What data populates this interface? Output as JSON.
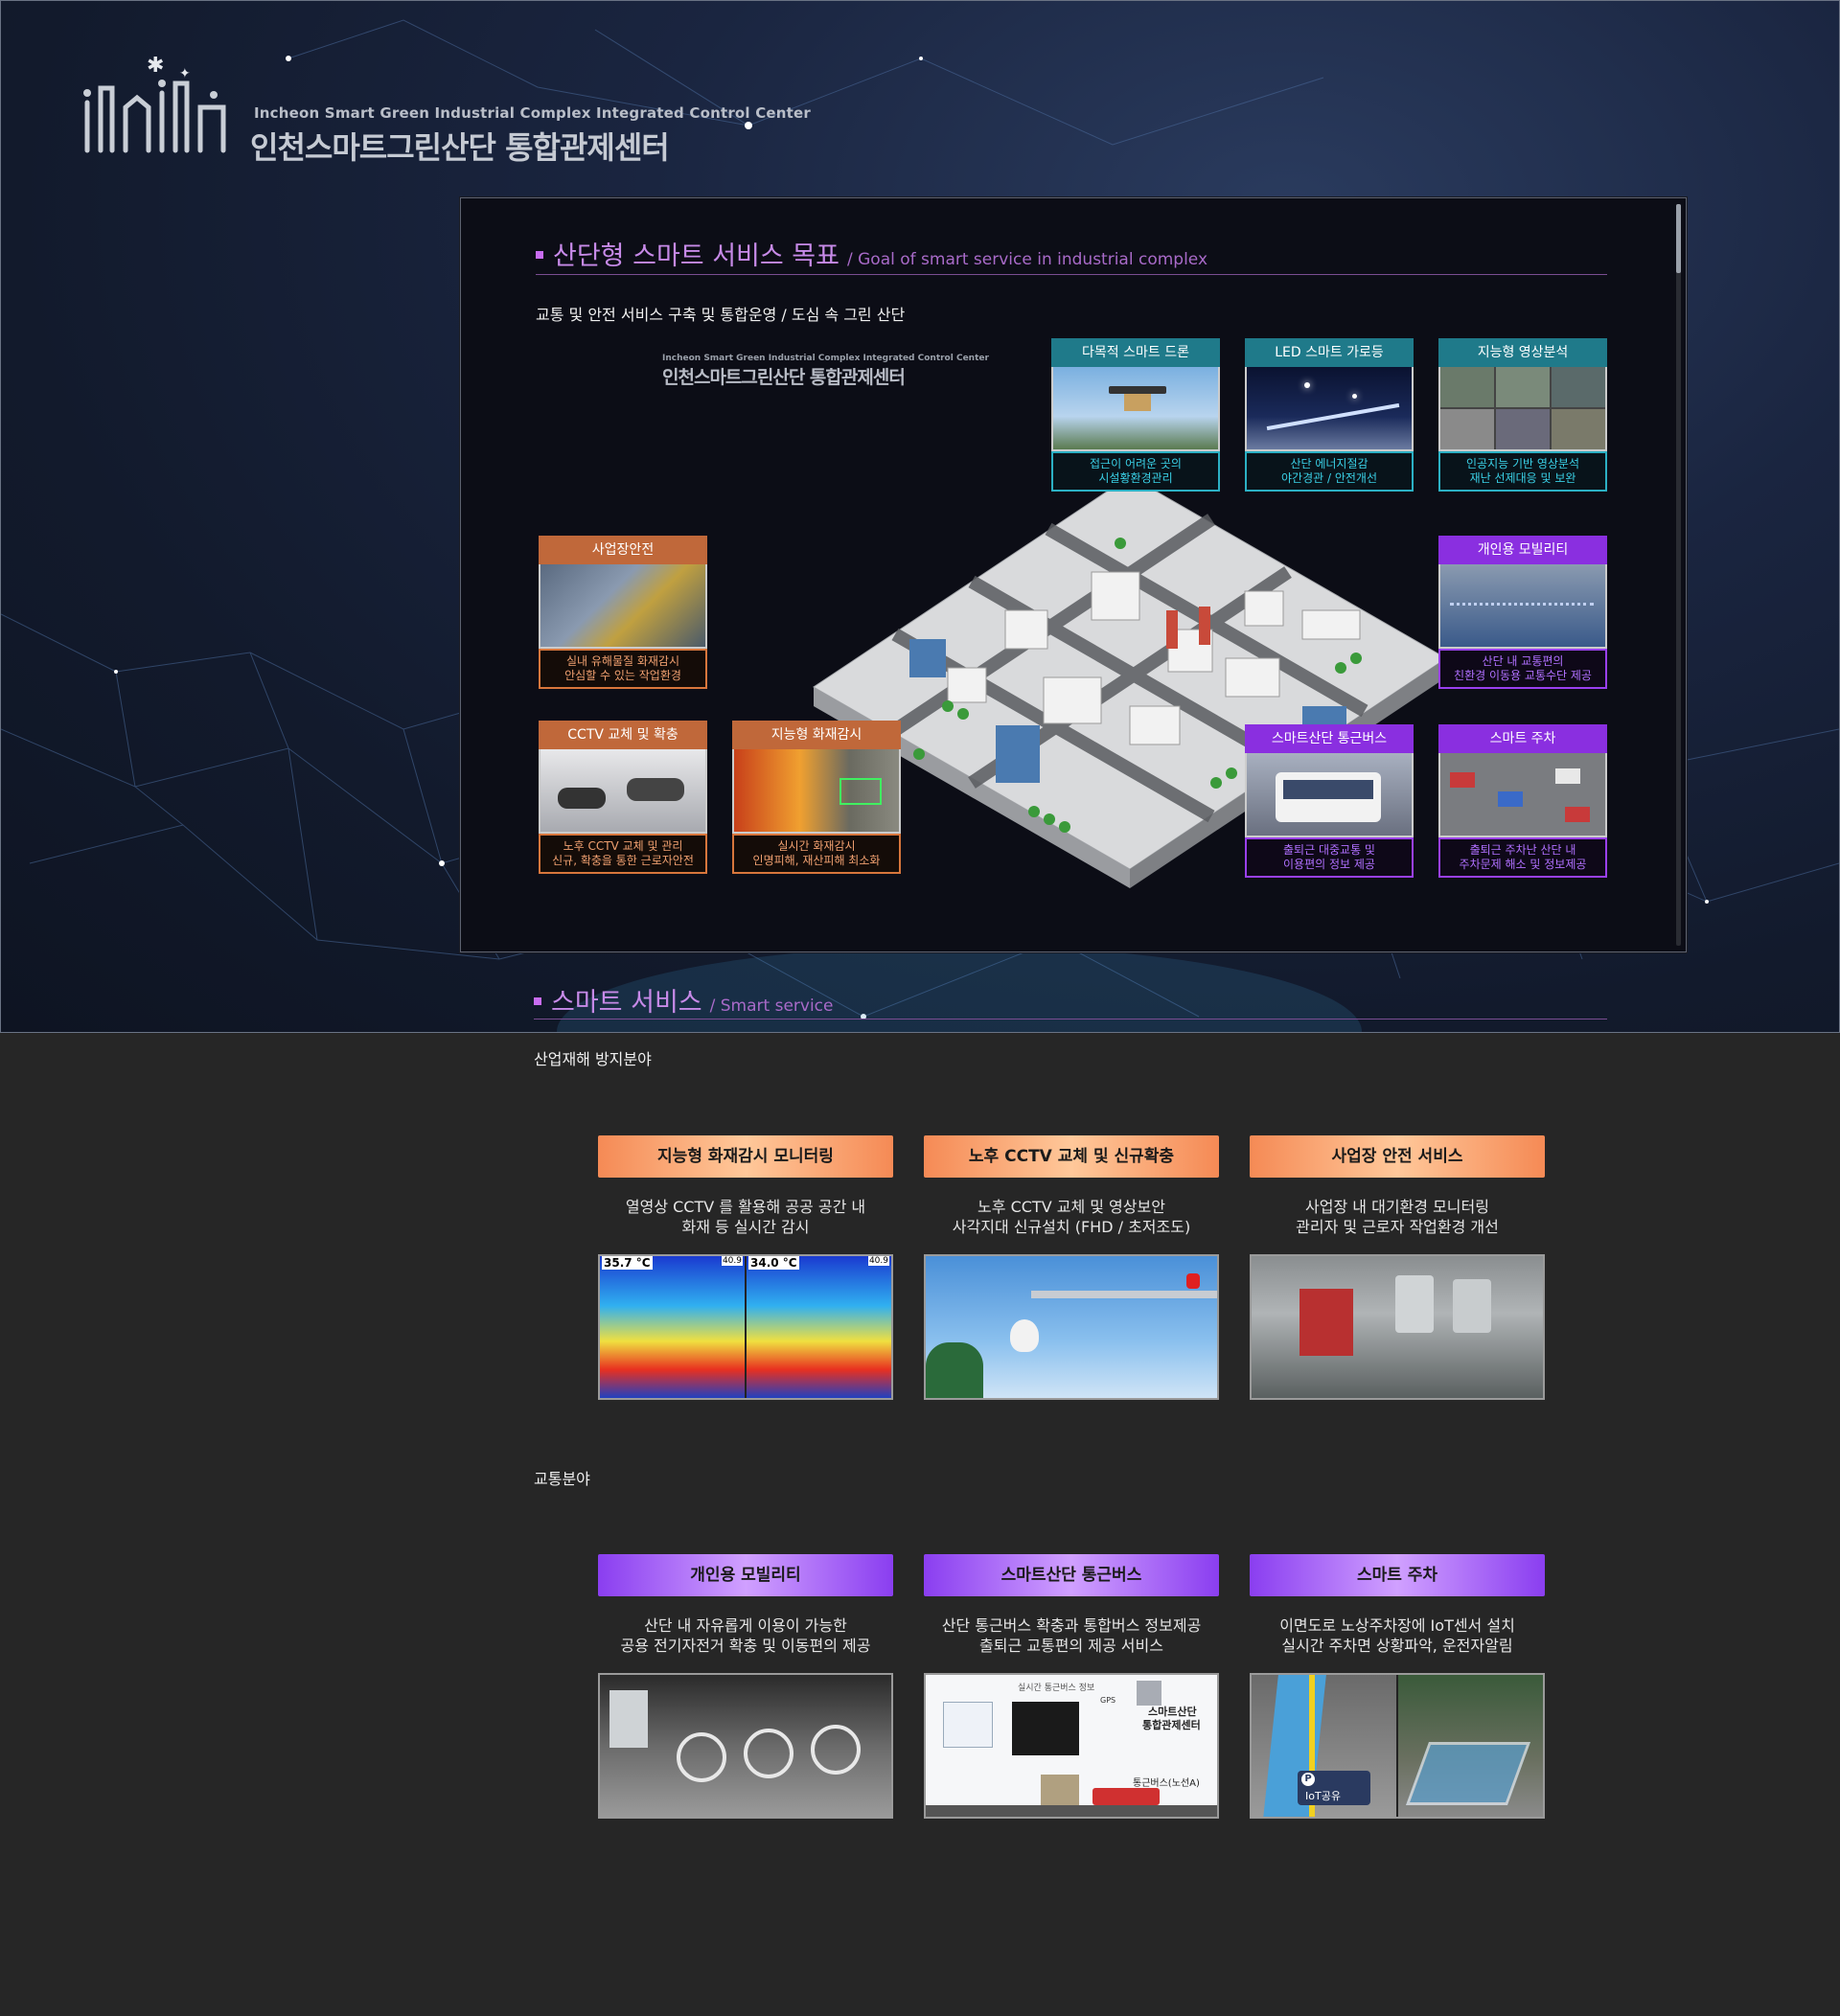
{
  "brand": {
    "name_en": "Incheon Smart Green Industrial Complex Integrated Control Center",
    "name_ko": "인천스마트그린산단 통합관제센터"
  },
  "goal_section": {
    "title_ko": "산단형 스마트 서비스 목표",
    "title_en": "/ Goal of smart service in industrial complex",
    "subtitle": "교통 및 안전 서비스 구축 및 통합운영 / 도심 속 그린 산단",
    "tiles": [
      {
        "title": "다목적 스마트 드론",
        "caption": [
          "접근이 어려운 곳의",
          "시설황환경관리"
        ],
        "theme": "teal"
      },
      {
        "title": "LED 스마트 가로등",
        "caption": [
          "산단 에너지절감",
          "야간경관 / 안전개선"
        ],
        "theme": "teal"
      },
      {
        "title": "지능형 영상분석",
        "caption": [
          "인공지능 기반 영상분석",
          "재난 선제대응 및 보완"
        ],
        "theme": "teal"
      },
      {
        "title": "사업장안전",
        "caption": [
          "실내 유해물질 화재감시",
          "안심할 수 있는 작업환경"
        ],
        "theme": "orange"
      },
      {
        "title": "개인용 모빌리티",
        "caption": [
          "산단 내 교통편의",
          "친환경 이동용 교통수단 제공"
        ],
        "theme": "purple"
      },
      {
        "title": "CCTV 교체 및 확충",
        "caption": [
          "노후 CCTV 교체 및 관리",
          "신규, 확충을 통한 근로자안전"
        ],
        "theme": "orange"
      },
      {
        "title": "지능형 화재감시",
        "caption": [
          "실시간 화재감시",
          "인명피해, 재산피해 최소화"
        ],
        "theme": "orange"
      },
      {
        "title": "스마트산단 통근버스",
        "caption": [
          "출퇴근 대중교통 및",
          "이용편의 정보 제공"
        ],
        "theme": "purple"
      },
      {
        "title": "스마트 주차",
        "caption": [
          "출퇴근 주차난 산단 내",
          "주차문제 해소 및 정보제공"
        ],
        "theme": "purple"
      }
    ],
    "map_logo": {
      "en": "Incheon Smart Green Industrial Complex Integrated Control Center",
      "ko": "인천스마트그린산단 통합관제센터"
    }
  },
  "service_section": {
    "title_ko": "스마트 서비스",
    "title_en": "/ Smart service",
    "categories": [
      {
        "name": "산업재해 방지분야",
        "items": [
          {
            "title": "지능형 화재감시 모니터링",
            "desc": [
              "열영상 CCTV 를 활용해 공공 공간 내",
              "화재 등 실시간 감시"
            ],
            "readouts": [
              "35.7 °C",
              "40.9",
              "34.0 °C",
              "40.9"
            ]
          },
          {
            "title": "노후 CCTV 교체 및 신규확충",
            "desc": [
              "노후 CCTV 교체 및 영상보안",
              "사각지대 신규설치 (FHD / 초저조도)"
            ]
          },
          {
            "title": "사업장 안전 서비스",
            "desc": [
              "사업장 내 대기환경 모니터링",
              "관리자 및 근로자 작업환경 개선"
            ]
          }
        ]
      },
      {
        "name": "교통분야",
        "items": [
          {
            "title": "개인용 모빌리티",
            "desc": [
              "산단 내 자유롭게 이용이 가능한",
              "공용 전기자전거 확충 및 이동편의 제공"
            ]
          },
          {
            "title": "스마트산단 통근버스",
            "desc": [
              "산단 통근버스 확충과 통합버스 정보제공",
              "출퇴근 교통편의 제공 서비스"
            ],
            "diagram": [
              "실시간 통근버스 정보",
              "스마트산단",
              "통합관제센터",
              "통근버스(노선A)",
              "GPS"
            ]
          },
          {
            "title": "스마트 주차",
            "desc": [
              "이면도로 노상주차장에 IoT센서 설치",
              "실시간 주차면 상황파악, 운전자알림"
            ],
            "photo_label": "IoT공유"
          }
        ]
      }
    ]
  },
  "colors": {
    "teal": "#1f7a8a",
    "orange": "#c0683a",
    "purple": "#8a2fe0",
    "accent": "#c78ae8"
  }
}
